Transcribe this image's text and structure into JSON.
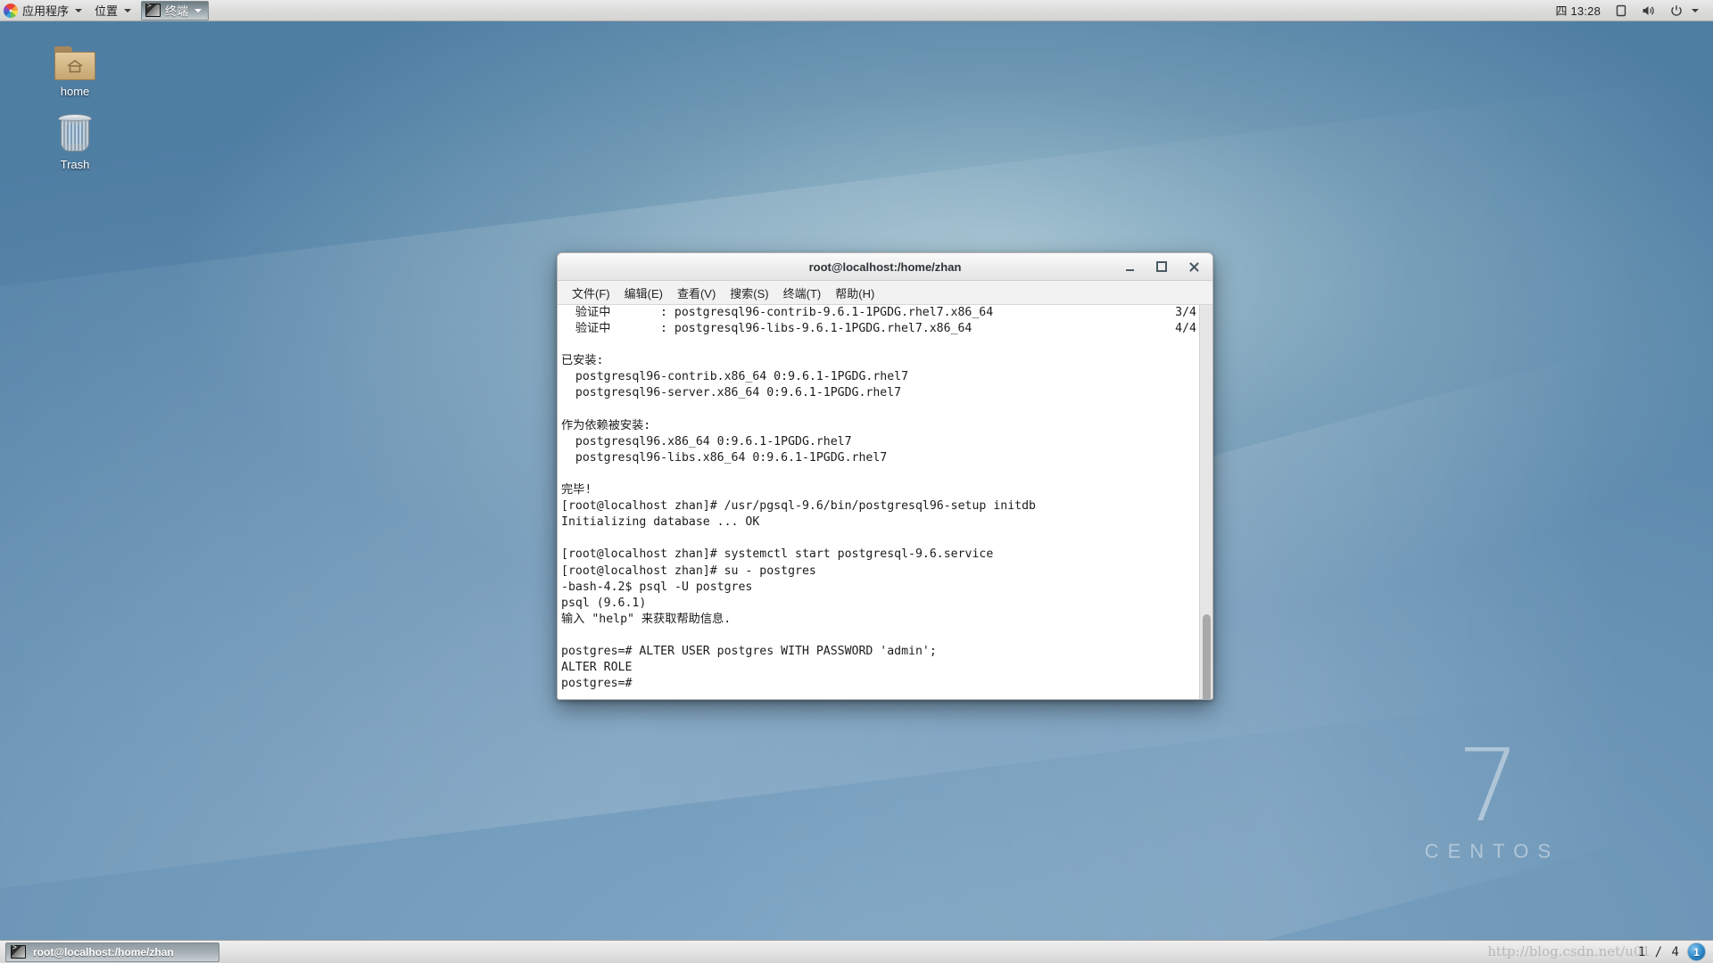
{
  "top_panel": {
    "logo_icon": "gnome-logo-icon",
    "applications_label": "应用程序",
    "places_label": "位置",
    "window_button_label": "终端",
    "window_button_icon": "terminal-icon",
    "clock": "四 13:28",
    "display_icon": "display-icon",
    "volume_icon": "volume-icon",
    "power_icon": "power-icon"
  },
  "desktop": {
    "icons": [
      {
        "label": "home",
        "icon": "home-folder-icon"
      },
      {
        "label": "Trash",
        "icon": "trash-icon"
      }
    ],
    "brand": {
      "version": "7",
      "name": "CENTOS"
    }
  },
  "terminal": {
    "title": "root@localhost:/home/zhan",
    "controls": {
      "minimize": "minimize-icon",
      "maximize": "maximize-icon",
      "close": "close-icon"
    },
    "menu": [
      "文件(F)",
      "编辑(E)",
      "查看(V)",
      "搜索(S)",
      "终端(T)",
      "帮助(H)"
    ],
    "lines": [
      {
        "text": "  验证中       : postgresql96-contrib-9.6.1-1PGDG.rhel7.x86_64",
        "right": "3/4"
      },
      {
        "text": "  验证中       : postgresql96-libs-9.6.1-1PGDG.rhel7.x86_64",
        "right": "4/4"
      },
      {
        "text": "",
        "right": ""
      },
      {
        "text": "已安装:",
        "right": ""
      },
      {
        "text": "  postgresql96-contrib.x86_64 0:9.6.1-1PGDG.rhel7",
        "right": ""
      },
      {
        "text": "  postgresql96-server.x86_64 0:9.6.1-1PGDG.rhel7",
        "right": ""
      },
      {
        "text": "",
        "right": ""
      },
      {
        "text": "作为依赖被安装:",
        "right": ""
      },
      {
        "text": "  postgresql96.x86_64 0:9.6.1-1PGDG.rhel7",
        "right": ""
      },
      {
        "text": "  postgresql96-libs.x86_64 0:9.6.1-1PGDG.rhel7",
        "right": ""
      },
      {
        "text": "",
        "right": ""
      },
      {
        "text": "完毕!",
        "right": ""
      },
      {
        "text": "[root@localhost zhan]# /usr/pgsql-9.6/bin/postgresql96-setup initdb",
        "right": ""
      },
      {
        "text": "Initializing database ... OK",
        "right": ""
      },
      {
        "text": "",
        "right": ""
      },
      {
        "text": "[root@localhost zhan]# systemctl start postgresql-9.6.service",
        "right": ""
      },
      {
        "text": "[root@localhost zhan]# su - postgres",
        "right": ""
      },
      {
        "text": "-bash-4.2$ psql -U postgres",
        "right": ""
      },
      {
        "text": "psql (9.6.1)",
        "right": ""
      },
      {
        "text": "输入 \"help\" 来获取帮助信息.",
        "right": ""
      },
      {
        "text": "",
        "right": ""
      },
      {
        "text": "postgres=# ALTER USER postgres WITH PASSWORD 'admin';",
        "right": ""
      },
      {
        "text": "ALTER ROLE",
        "right": ""
      },
      {
        "text": "postgres=#",
        "right": ""
      }
    ]
  },
  "bottom_panel": {
    "task_label": "root@localhost:/home/zhan",
    "task_icon": "terminal-icon",
    "workspace_label": "1 / 4",
    "workspace_badge": "1",
    "watermark": "http://blog.csdn.net/u01"
  }
}
